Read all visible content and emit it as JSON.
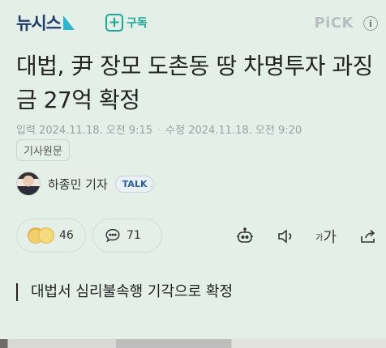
{
  "header": {
    "logo_text": "뉴시스",
    "subscribe_label": "구독",
    "pick_label": "PiCK",
    "info_label": "i"
  },
  "article": {
    "title": "대법, 尹 장모 도촌동 땅 차명투자 과징금 27억 확정",
    "input_date": "입력 2024.11.18. 오전 9:15",
    "modified_date": "수정 2024.11.18. 오전 9:20",
    "original_tag": "기사원문",
    "reporter": "하종민 기자",
    "talk_label": "TALK",
    "summary": "대법서 심리불속행 기각으로 확정"
  },
  "actions": {
    "reaction_count": "46",
    "comment_count": "71",
    "font_small": "가",
    "font_large": "가"
  },
  "colors": {
    "background": "#e3efe7",
    "brand_navy": "#1f3d6b",
    "subscribe_teal": "#1aa897"
  }
}
